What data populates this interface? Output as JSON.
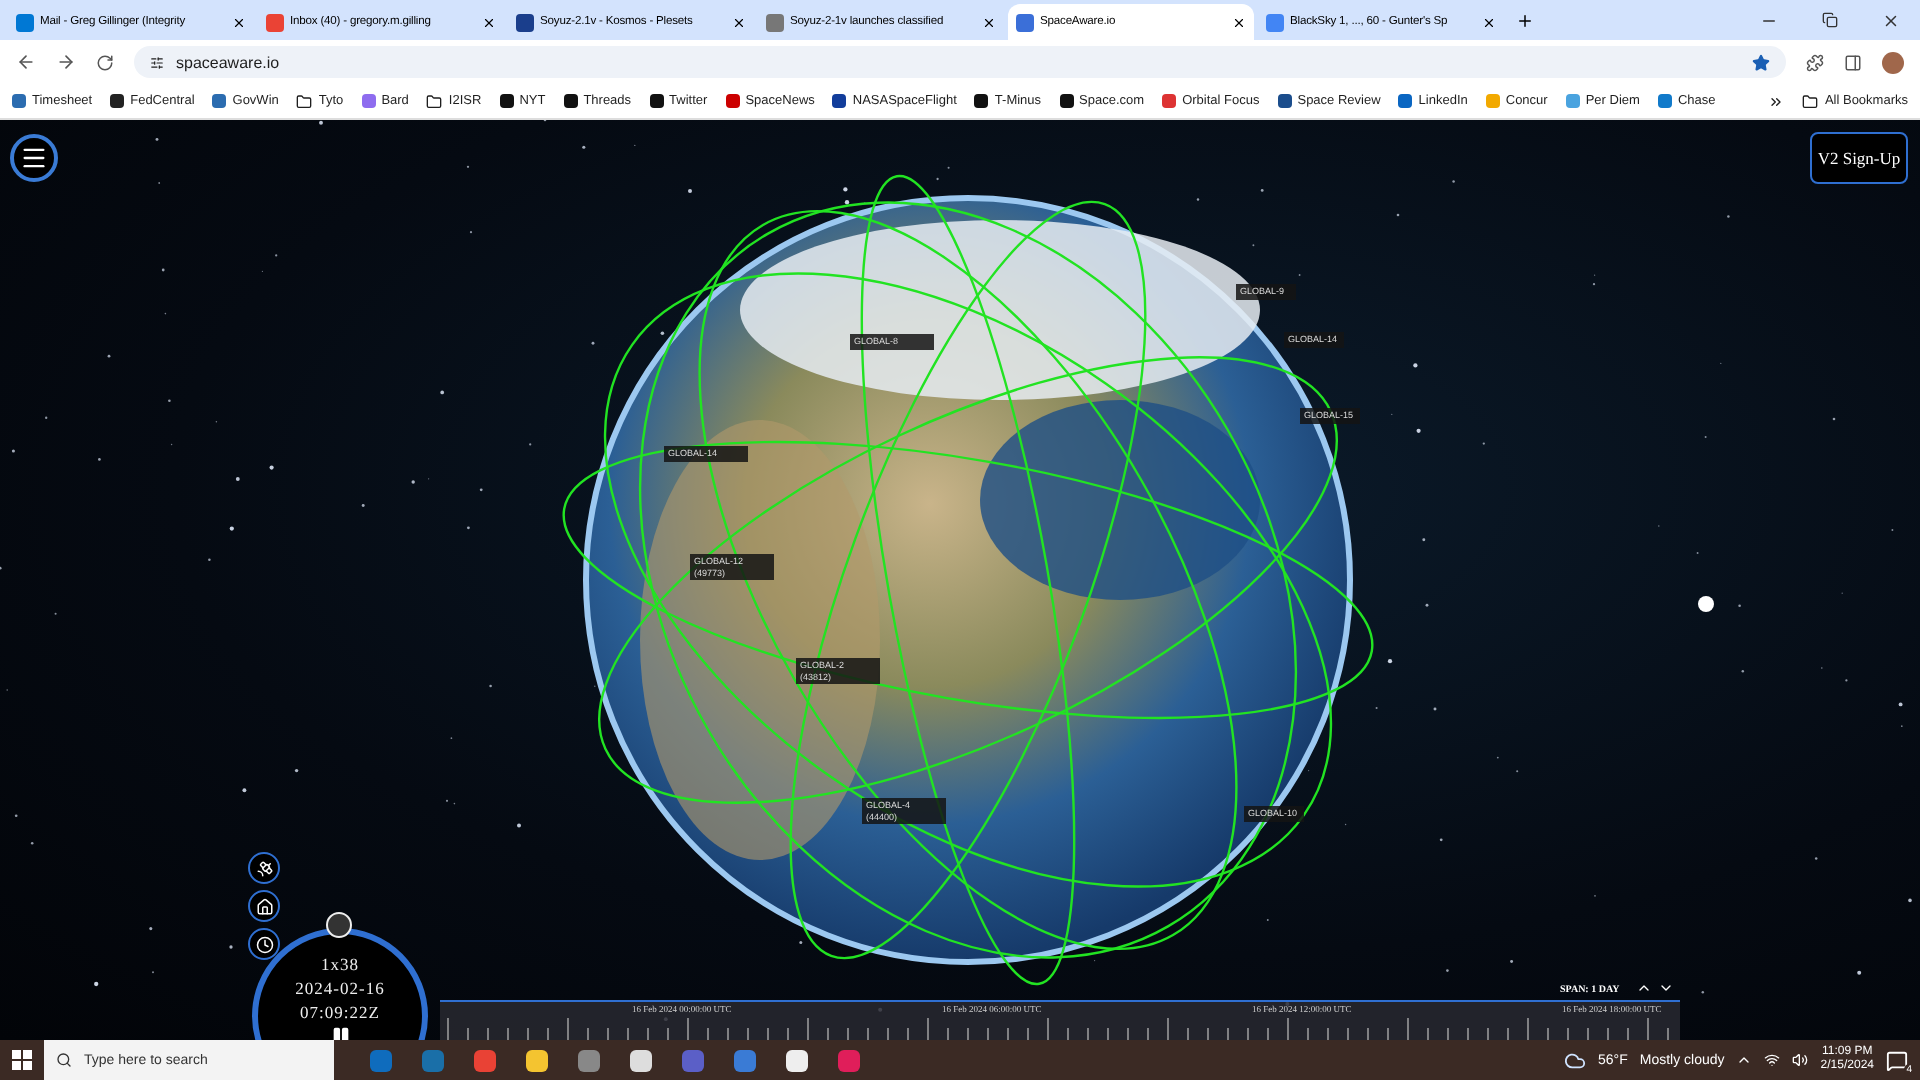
{
  "browser": {
    "tabs": [
      {
        "title": "Mail - Greg Gillinger (Integrity",
        "selected": false
      },
      {
        "title": "Inbox (40) - gregory.m.gilling",
        "selected": false
      },
      {
        "title": "Soyuz-2.1v - Kosmos - Plesets",
        "selected": false
      },
      {
        "title": "Soyuz-2-1v launches classified",
        "selected": false
      },
      {
        "title": "SpaceAware.io",
        "selected": true
      },
      {
        "title": "BlackSky 1, ..., 60 - Gunter's Sp",
        "selected": false
      }
    ],
    "address": "spaceaware.io",
    "bookmarks": [
      {
        "label": "Timesheet",
        "kind": "site"
      },
      {
        "label": "FedCentral",
        "kind": "site"
      },
      {
        "label": "GovWin",
        "kind": "site"
      },
      {
        "label": "Tyto",
        "kind": "folder"
      },
      {
        "label": "Bard",
        "kind": "site"
      },
      {
        "label": "I2ISR",
        "kind": "folder"
      },
      {
        "label": "NYT",
        "kind": "site"
      },
      {
        "label": "Threads",
        "kind": "site"
      },
      {
        "label": "Twitter",
        "kind": "site"
      },
      {
        "label": "SpaceNews",
        "kind": "site"
      },
      {
        "label": "NASASpaceFlight",
        "kind": "site"
      },
      {
        "label": "T-Minus",
        "kind": "site"
      },
      {
        "label": "Space.com",
        "kind": "site"
      },
      {
        "label": "Orbital Focus",
        "kind": "site"
      },
      {
        "label": "Space Review",
        "kind": "site"
      },
      {
        "label": "LinkedIn",
        "kind": "site"
      },
      {
        "label": "Concur",
        "kind": "site"
      },
      {
        "label": "Per Diem",
        "kind": "site"
      },
      {
        "label": "Chase",
        "kind": "site"
      }
    ],
    "all_bookmarks": "All Bookmarks"
  },
  "app": {
    "signup_button": "V2 Sign-Up",
    "satellites": [
      {
        "name": "GLOBAL-8"
      },
      {
        "name": "GLOBAL-9"
      },
      {
        "name": "GLOBAL-14"
      },
      {
        "name": "GLOBAL-15"
      },
      {
        "name": "GLOBAL-14"
      },
      {
        "name": "GLOBAL-12",
        "number": "(49773)"
      },
      {
        "name": "GLOBAL-2",
        "number": "(43812)"
      },
      {
        "name": "GLOBAL-4",
        "number": "(44400)"
      },
      {
        "name": "GLOBAL-10"
      }
    ],
    "clock": {
      "speed": "1x38",
      "date": "2024-02-16",
      "time": "07:09:22Z"
    },
    "timeline": {
      "span": "SPAN: 1 DAY",
      "ticks": [
        "16 Feb 2024 00:00:00 UTC",
        "16 Feb 2024 06:00:00 UTC",
        "16 Feb 2024 12:00:00 UTC",
        "16 Feb 2024 18:00:00 UTC"
      ]
    }
  },
  "taskbar": {
    "search_placeholder": "Type here to search",
    "temperature": "56°F",
    "weather": "Mostly cloudy",
    "time": "11:09 PM",
    "date": "2/15/2024",
    "notifications": "4"
  }
}
